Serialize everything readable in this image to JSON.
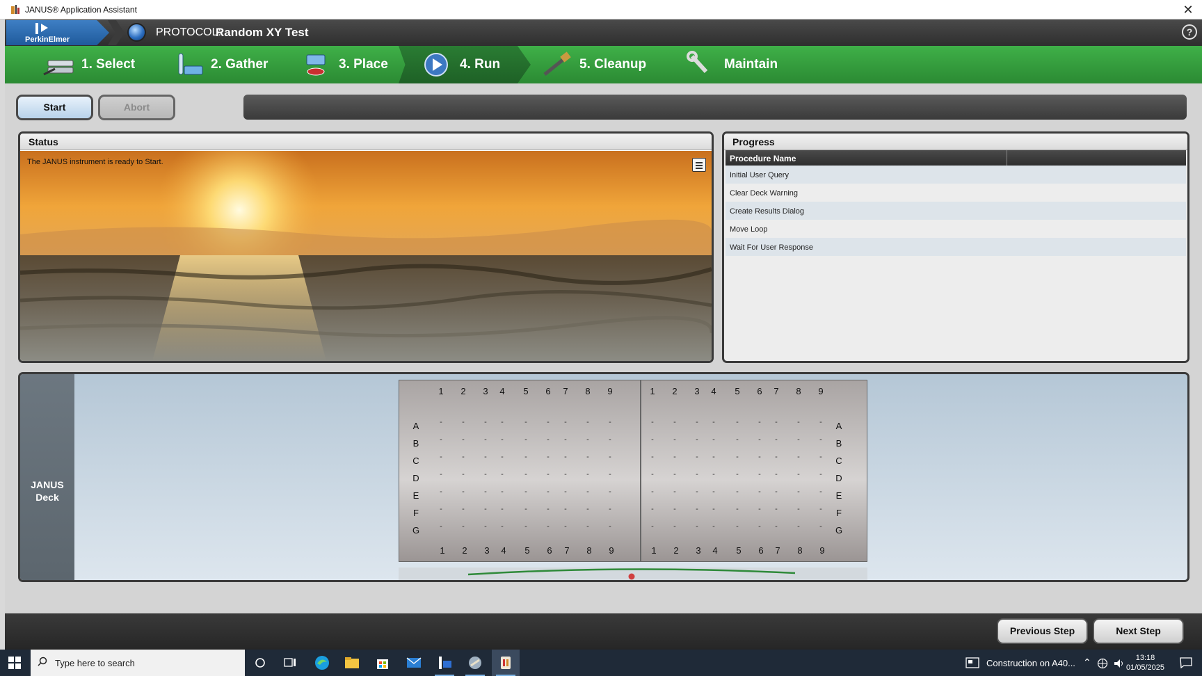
{
  "window": {
    "title": "JANUS® Application Assistant",
    "close_glyph": "✕"
  },
  "header": {
    "brand": "PerkinElmer",
    "protocol_prefix": "PROTOCOL:",
    "protocol_name": "Random XY Test",
    "help_glyph": "?"
  },
  "steps": [
    {
      "label": "1. Select",
      "icon": "select-icon"
    },
    {
      "label": "2. Gather",
      "icon": "gather-icon"
    },
    {
      "label": "3. Place",
      "icon": "place-icon"
    },
    {
      "label": "4. Run",
      "icon": "play-icon",
      "active": true
    },
    {
      "label": "5. Cleanup",
      "icon": "brush-icon"
    },
    {
      "label": "Maintain",
      "icon": "wrench-icon"
    }
  ],
  "controls": {
    "start": "Start",
    "abort": "Abort"
  },
  "status": {
    "title": "Status",
    "message": "The JANUS instrument is ready to Start."
  },
  "progress": {
    "title": "Progress",
    "column": "Procedure Name",
    "rows": [
      "Initial User Query",
      "Clear Deck Warning",
      "Create Results Dialog",
      "Move Loop",
      "Wait For User Response"
    ]
  },
  "deck": {
    "label_line1": "JANUS",
    "label_line2": "Deck",
    "columns": [
      "1",
      "2",
      "3",
      "4",
      "5",
      "6",
      "7",
      "8",
      "9"
    ],
    "rows": [
      "A",
      "B",
      "C",
      "D",
      "E",
      "F",
      "G"
    ],
    "empty_glyph": "-"
  },
  "footer": {
    "previous": "Previous Step",
    "next": "Next Step"
  },
  "taskbar": {
    "search_placeholder": "Type here to search",
    "news": "Construction on A40...",
    "time": "13:18",
    "date": "01/05/2025"
  },
  "colors": {
    "step_bar": "#2f9a39",
    "active_step": "#1f6527",
    "header": "#333333",
    "accent_blue": "#2d6fc2"
  }
}
